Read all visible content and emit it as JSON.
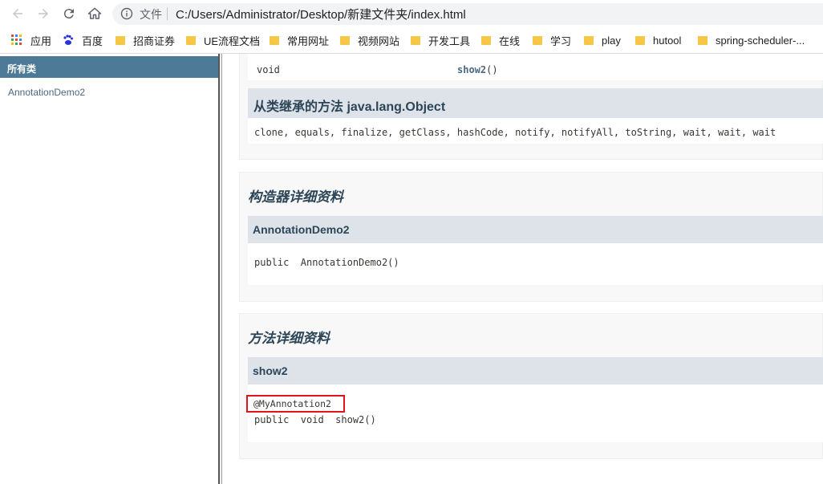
{
  "browser": {
    "url_label": "文件",
    "url": "C:/Users/Administrator/Desktop/新建文件夹/index.html",
    "bookmarks": [
      {
        "label": "应用",
        "icon": "apps-grid-icon"
      },
      {
        "label": "百度",
        "icon": "baidu-paw-icon"
      },
      {
        "label": "招商证券",
        "icon": "folder-icon"
      },
      {
        "label": "UE流程文档",
        "icon": "folder-icon"
      },
      {
        "label": "常用网址",
        "icon": "folder-icon"
      },
      {
        "label": "视频网站",
        "icon": "folder-icon"
      },
      {
        "label": "开发工具",
        "icon": "folder-icon"
      },
      {
        "label": "在线",
        "icon": "folder-icon"
      },
      {
        "label": "学习",
        "icon": "folder-icon"
      },
      {
        "label": "play",
        "icon": "folder-icon"
      },
      {
        "label": "hutool",
        "icon": "folder-icon"
      },
      {
        "label": "spring-scheduler-...",
        "icon": "folder-icon"
      }
    ]
  },
  "left_frame": {
    "header": "所有类",
    "classes": [
      "AnnotationDemo2"
    ]
  },
  "summary": {
    "row_type": "void",
    "row_method": "show2",
    "row_params": "()",
    "inherited_heading": "从类继承的方法 java.lang.Object",
    "inherited_methods": "clone, equals, finalize, getClass, hashCode, notify, notifyAll, toString, wait, wait, wait"
  },
  "constructor_detail": {
    "title": "构造器详细资料",
    "name": "AnnotationDemo2",
    "signature": "public  AnnotationDemo2()"
  },
  "method_detail": {
    "title": "方法详细资料",
    "name": "show2",
    "annotation": "@MyAnnotation2",
    "signature": "public  void  show2()"
  },
  "colors": {
    "header_bar": "#4d7a97",
    "table_head": "#dee3e9",
    "highlight": "#e0141b"
  }
}
